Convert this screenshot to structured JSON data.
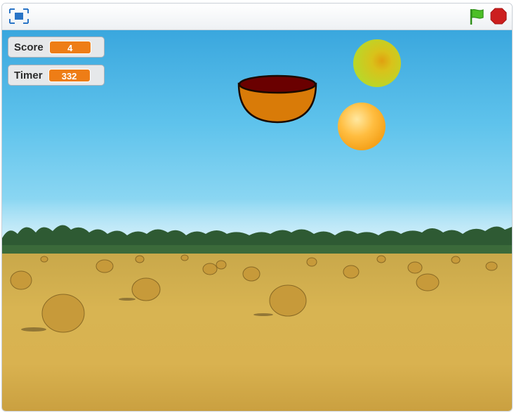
{
  "toolbar": {
    "fullscreen_icon": "fullscreen-icon",
    "green_flag_icon": "green-flag-icon",
    "stop_icon": "stop-sign-icon"
  },
  "monitors": {
    "score": {
      "label": "Score",
      "value": "4"
    },
    "timer": {
      "label": "Timer",
      "value": "332"
    }
  },
  "sprites": {
    "bowl": "bowl",
    "fruits": [
      "green-yellow-ball",
      "orange-ball"
    ]
  },
  "colors": {
    "monitor_value_bg": "#ee7d16",
    "flag_green": "#4cbf26",
    "stop_red": "#cc1f1f",
    "bowl_body": "#d97b08",
    "bowl_inside": "#6a0000"
  }
}
